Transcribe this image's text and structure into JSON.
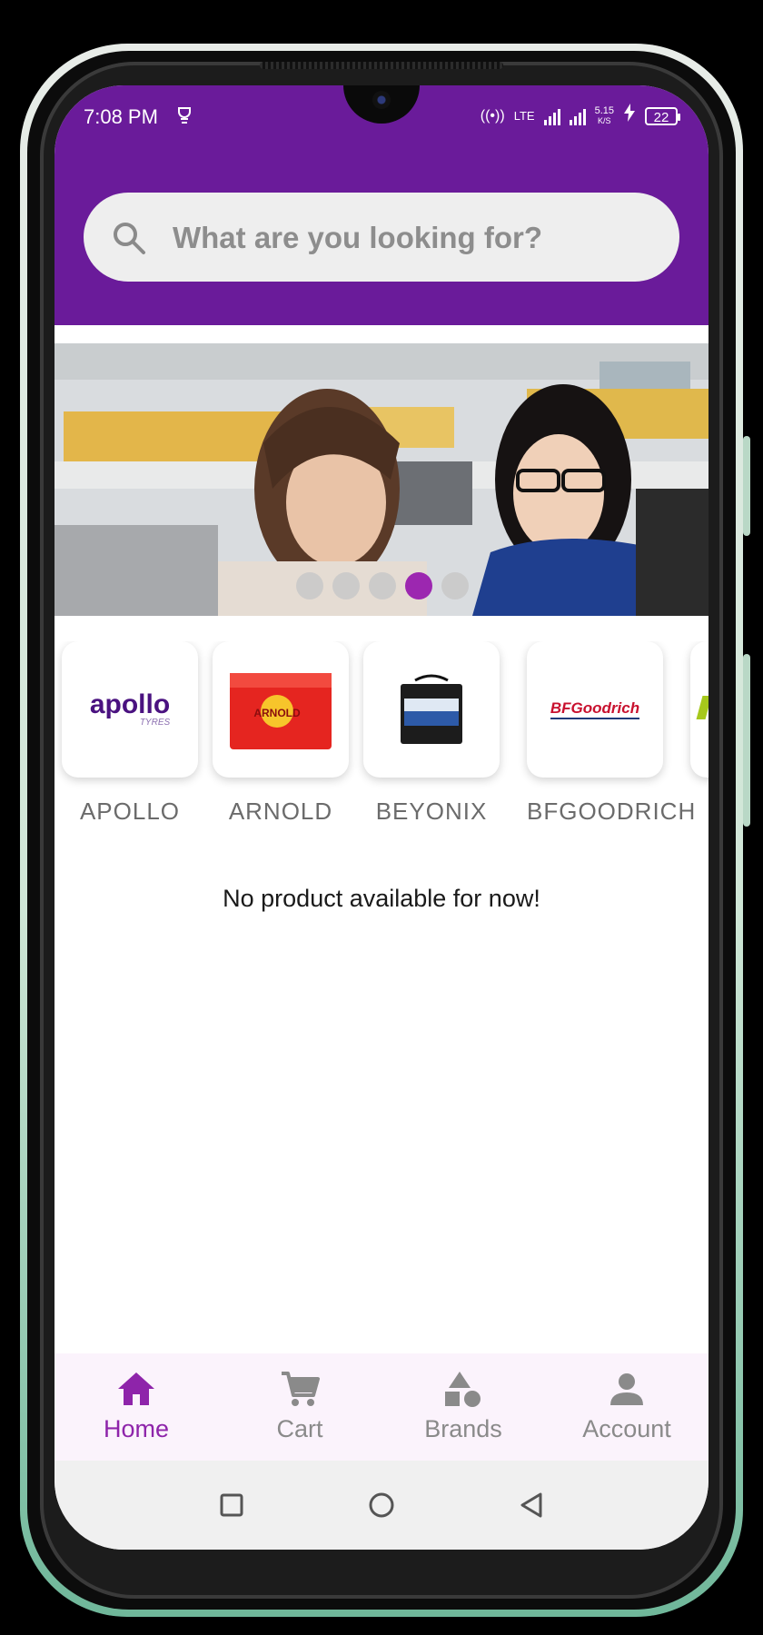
{
  "status_bar": {
    "time": "7:08 PM",
    "network": "LTE",
    "speed_value": "5.15",
    "speed_unit": "K/S",
    "battery": "22"
  },
  "search": {
    "placeholder": "What are you looking for?"
  },
  "carousel": {
    "dot_count": 5,
    "active_index": 3
  },
  "brands": [
    {
      "name": "APOLLO",
      "logo_text": "apollo",
      "logo_sub": "TYRES"
    },
    {
      "name": "ARNOLD",
      "logo_text": "ARNOLD"
    },
    {
      "name": "BEYONIX"
    },
    {
      "name": "BFGOODRICH",
      "logo_text": "BFGoodrich"
    }
  ],
  "empty_state": "No product available for now!",
  "bottom_nav": {
    "home": "Home",
    "cart": "Cart",
    "brands": "Brands",
    "account": "Account",
    "active": "home"
  },
  "colors": {
    "primary": "#6a1b9a",
    "accent": "#9c27b0",
    "active_nav": "#8e24aa"
  }
}
